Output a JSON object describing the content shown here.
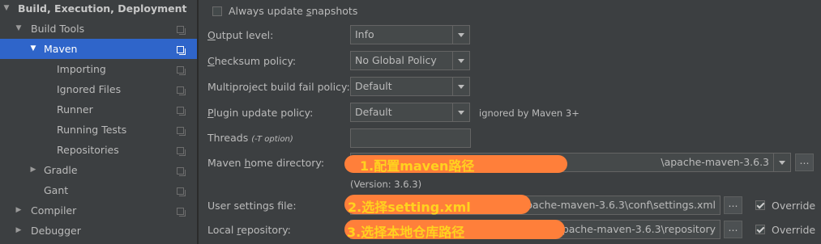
{
  "tree": [
    {
      "label": "Build, Execution, Deployment",
      "expanded": true
    },
    {
      "label": "Build Tools",
      "expanded": true
    },
    {
      "label": "Maven",
      "expanded": true,
      "selected": true
    },
    {
      "label": "Importing"
    },
    {
      "label": "Ignored Files"
    },
    {
      "label": "Runner"
    },
    {
      "label": "Running Tests"
    },
    {
      "label": "Repositories"
    },
    {
      "label": "Gradle",
      "expanded": false
    },
    {
      "label": "Gant"
    },
    {
      "label": "Compiler",
      "expanded": false
    },
    {
      "label": "Debugger",
      "expanded": false
    }
  ],
  "maven": {
    "always_update": {
      "label_pre": "Always update ",
      "label_u": "s",
      "label_post": "napshots",
      "checked": false
    },
    "output_level": {
      "label_u": "O",
      "label_post": "utput level:",
      "value": "Info"
    },
    "checksum_policy": {
      "label_u": "C",
      "label_post": "hecksum policy:",
      "value": "No Global Policy"
    },
    "multiproject": {
      "label": "Multiproject build fail policy:",
      "value": "Default"
    },
    "plugin_update": {
      "label_u": "P",
      "label_post": "lugin update policy:",
      "value": "Default",
      "note": "ignored by Maven 3+"
    },
    "threads": {
      "label": "Threads ",
      "hint": "(-T option)",
      "value": ""
    },
    "home": {
      "label_pre": "Maven ",
      "label_u": "h",
      "label_post": "ome directory:",
      "value": "\\apache-maven-3.6.3",
      "version": "(Version: 3.6.3)"
    },
    "user_settings": {
      "label": "User settings file:",
      "value": "..\\apache-maven-3.6.3\\conf\\settings.xml",
      "override_label": "Override",
      "override": true
    },
    "local_repo": {
      "label_pre": "Local ",
      "label_u": "r",
      "label_post": "epository:",
      "value": "\\apache-maven-3.6.3\\repository",
      "override_label": "Override",
      "override": true
    }
  },
  "annotations": {
    "a1": "1.配置maven路径",
    "a2": "2.选择setting.xml",
    "a3": "3.选择本地仓库路径"
  },
  "dots_label": "...",
  "colors": {
    "selection": "#2f65ca",
    "highlight": "#ff7f3a",
    "annotation": "#ffd21f",
    "background": "#3c3f41"
  }
}
